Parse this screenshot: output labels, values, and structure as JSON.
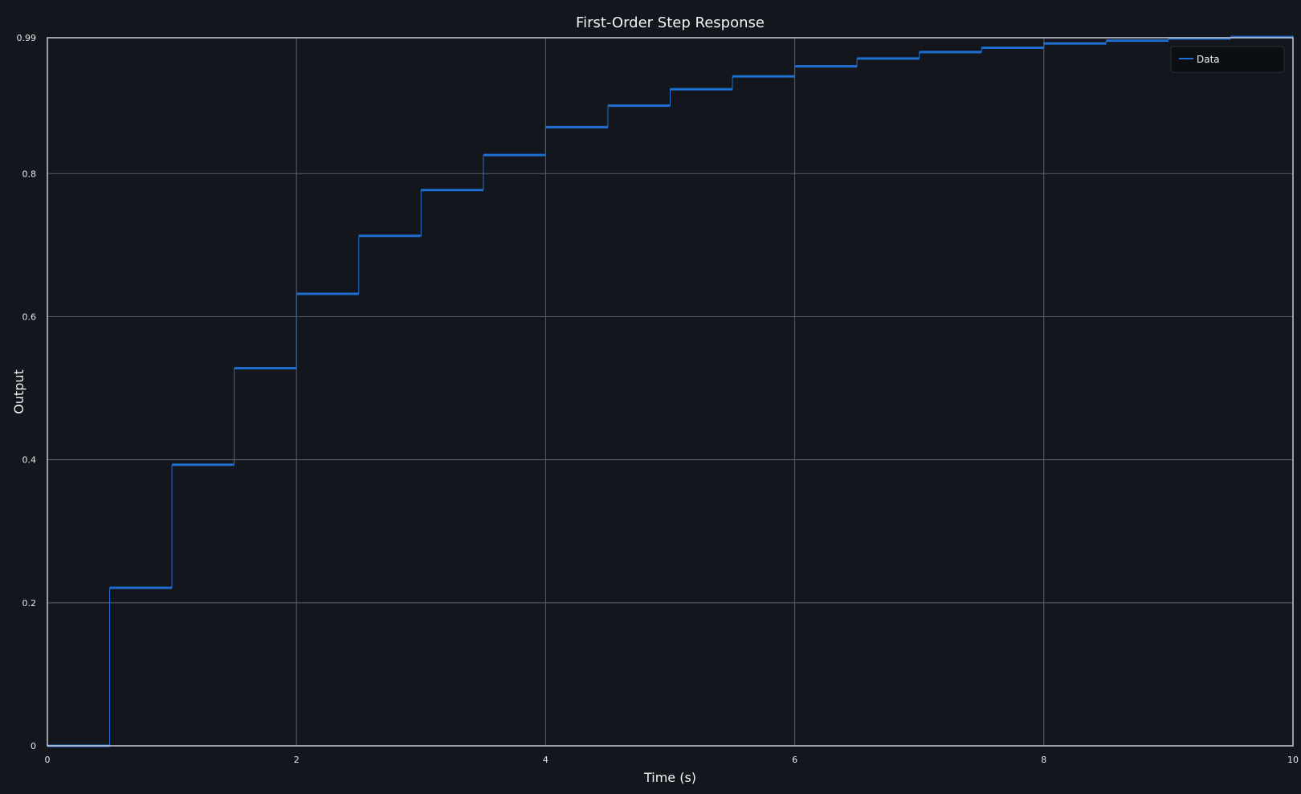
{
  "chart_data": {
    "type": "line",
    "step": "post",
    "title": "First-Order Step Response",
    "xlabel": "Time (s)",
    "ylabel": "Output",
    "xlim": [
      0,
      10
    ],
    "ylim": [
      0,
      0.99
    ],
    "x_ticks": [
      0,
      2,
      4,
      6,
      8,
      10
    ],
    "y_ticks": [
      0,
      0.2,
      0.4,
      0.6,
      0.8,
      0.99
    ],
    "x_tick_labels": [
      "0",
      "2",
      "4",
      "6",
      "8",
      "10"
    ],
    "y_tick_labels": [
      "0",
      "0.2",
      "0.4",
      "0.6",
      "0.8",
      "0.99"
    ],
    "grid": true,
    "legend_position": "top-right",
    "background_color": "#13171d",
    "series": [
      {
        "name": "Data",
        "color": "#1f6fd1",
        "x": [
          0,
          0.5,
          1.0,
          1.5,
          2.0,
          2.5,
          3.0,
          3.5,
          4.0,
          4.5,
          5.0,
          5.5,
          6.0,
          6.5,
          7.0,
          7.5,
          8.0,
          8.5,
          9.0,
          9.5,
          10.0
        ],
        "y": [
          0,
          0.221,
          0.393,
          0.528,
          0.632,
          0.713,
          0.777,
          0.826,
          0.865,
          0.895,
          0.918,
          0.936,
          0.95,
          0.961,
          0.97,
          0.976,
          0.982,
          0.986,
          0.989,
          0.991,
          0.993
        ]
      }
    ]
  }
}
